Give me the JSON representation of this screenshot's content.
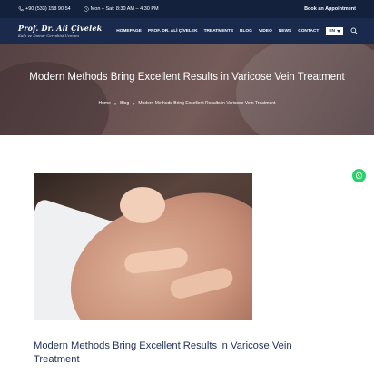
{
  "topbar": {
    "phone": "+90 (533) 158 90 54",
    "hours": "Mon – Sat: 8:30 AM – 4:30 PM",
    "appointment": "Book an Appointment"
  },
  "logo": {
    "name": "Prof. Dr. Ali Çivelek",
    "tagline": "Kalp ve Damar Cerrahisi Uzmanı"
  },
  "nav": {
    "items": [
      "HOMEPAGE",
      "PROF. DR. ALİ ÇİVELEK",
      "TREATMENTS",
      "BLOG",
      "VIDEO",
      "NEWS",
      "CONTACT"
    ],
    "language": "EN"
  },
  "hero": {
    "title": "Modern Methods Bring Excellent Results in Varicose Vein Treatment",
    "breadcrumb": [
      "Home",
      "Blog",
      "Modern Methods Bring Excellent Results in Varicose Vein Treatment"
    ]
  },
  "article": {
    "title": "Modern Methods Bring Excellent Results in Varicose Vein Treatment"
  },
  "colors": {
    "topbar": "#14213d",
    "nav": "#1a2a4c",
    "heading": "#1f2f5b",
    "whatsapp": "#25d366"
  }
}
